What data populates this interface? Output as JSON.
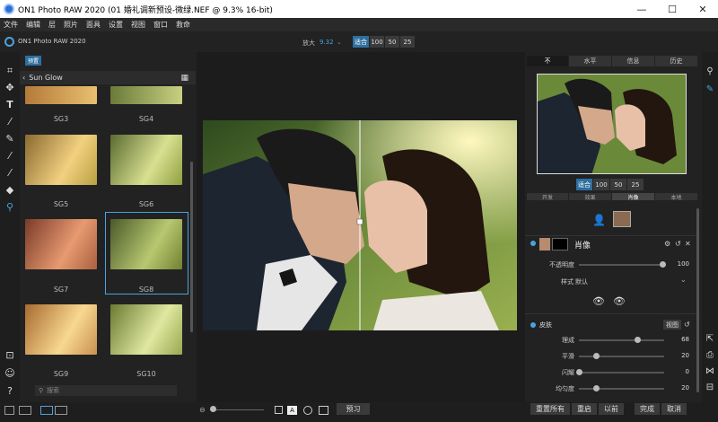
{
  "window": {
    "title": "ON1 Photo RAW 2020 (01 婚礼调新预设-微绿.NEF @ 9.3% 16-bit)",
    "minimize": "—",
    "maximize": "☐",
    "close": "✕"
  },
  "menu": [
    "文件",
    "编辑",
    "层",
    "照片",
    "面具",
    "设置",
    "视图",
    "窗口",
    "救命"
  ],
  "app": {
    "logo_text": "ON1 Photo RAW 2020"
  },
  "zoom": {
    "label": "放大",
    "value": "9.32",
    "buttons": [
      "适合",
      "100",
      "50",
      "25"
    ],
    "active": "适合"
  },
  "browser": {
    "tab": "预置",
    "category": "Sun Glow",
    "presets": [
      "SG3",
      "SG4",
      "SG5",
      "SG6",
      "SG7",
      "SG8",
      "SG9",
      "SG10"
    ],
    "selected": "SG8",
    "search_placeholder": "搜索"
  },
  "right_tabs": [
    "不",
    "水平",
    "信息",
    "历史"
  ],
  "right_tab_active": "不",
  "nav_zoom_buttons": [
    "适合",
    "100",
    "50",
    "25"
  ],
  "sub_tabs": [
    "开发",
    "效果",
    "肖像",
    "本地"
  ],
  "sub_tab_active": "肖像",
  "portrait": {
    "title": "肖像",
    "opacity_label": "不透明度",
    "opacity_value": "100",
    "style_label": "样式",
    "style_value": "默认"
  },
  "skin": {
    "title": "皮肤",
    "view_button": "视图",
    "rows": [
      {
        "label": "理成",
        "value": "68",
        "level": 0.68
      },
      {
        "label": "平滑",
        "value": "20",
        "level": 0.2
      },
      {
        "label": "闪耀",
        "value": "0",
        "level": 0.0
      },
      {
        "label": "均匀度",
        "value": "20",
        "level": 0.2
      }
    ]
  },
  "bottom": {
    "preview_button": "预习",
    "reset_all": "重置所有",
    "reset": "重启",
    "previous": "以前",
    "done": "完成",
    "cancel": "取消"
  },
  "colors": {
    "accent": "#4aa3e0",
    "panel": "#222222",
    "active_tab": "#2e6f9e"
  }
}
